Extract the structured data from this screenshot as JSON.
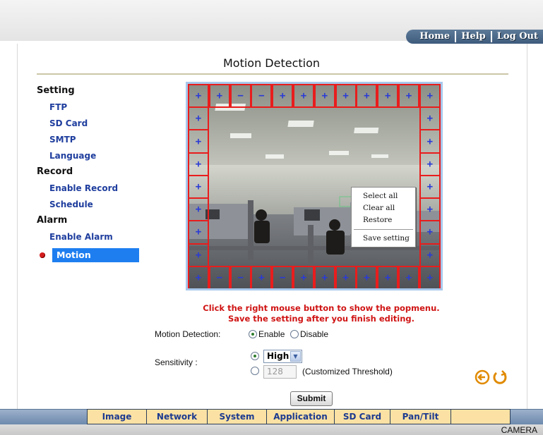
{
  "top_nav": {
    "home": "Home",
    "help": "Help",
    "logout": "Log Out"
  },
  "page": {
    "title": "Motion Detection"
  },
  "sidebar": {
    "sections": [
      {
        "heading": "Setting",
        "items": [
          "FTP",
          "SD Card",
          "SMTP",
          "Language"
        ]
      },
      {
        "heading": "Record",
        "items": [
          "Enable Record",
          "Schedule"
        ]
      },
      {
        "heading": "Alarm",
        "items": [
          "Enable Alarm"
        ]
      }
    ],
    "active_item": "Motion Detection"
  },
  "context_menu": {
    "items": [
      "Select all",
      "Clear all",
      "Restore",
      "Save setting"
    ]
  },
  "grid": {
    "cell_symbol": "+",
    "cell_symbol_dim": "−"
  },
  "instructions": {
    "line1": "Click the right mouse button to show the popmenu.",
    "line2": "Save the setting after you finish editing."
  },
  "form": {
    "motion_label": "Motion Detection:",
    "enable_label": "Enable",
    "disable_label": "Disable",
    "motion_value": "Enable",
    "sensitivity_label": "Sensitivity :",
    "sensitivity_value": "High",
    "threshold_value": "128",
    "threshold_note": "(Customized Threshold)",
    "submit_label": "Submit"
  },
  "icons": {
    "back": "back-arrow-icon",
    "refresh": "refresh-icon"
  },
  "tabs": [
    "Image",
    "Network",
    "System",
    "Application",
    "SD Card",
    "Pan/Tilt",
    ""
  ],
  "footer": {
    "text": "CAMERA"
  },
  "colors": {
    "accent": "#1e7ef0",
    "alert": "#d01414",
    "grid": "#e81d1d",
    "tab_bg": "#fbe2a4"
  }
}
